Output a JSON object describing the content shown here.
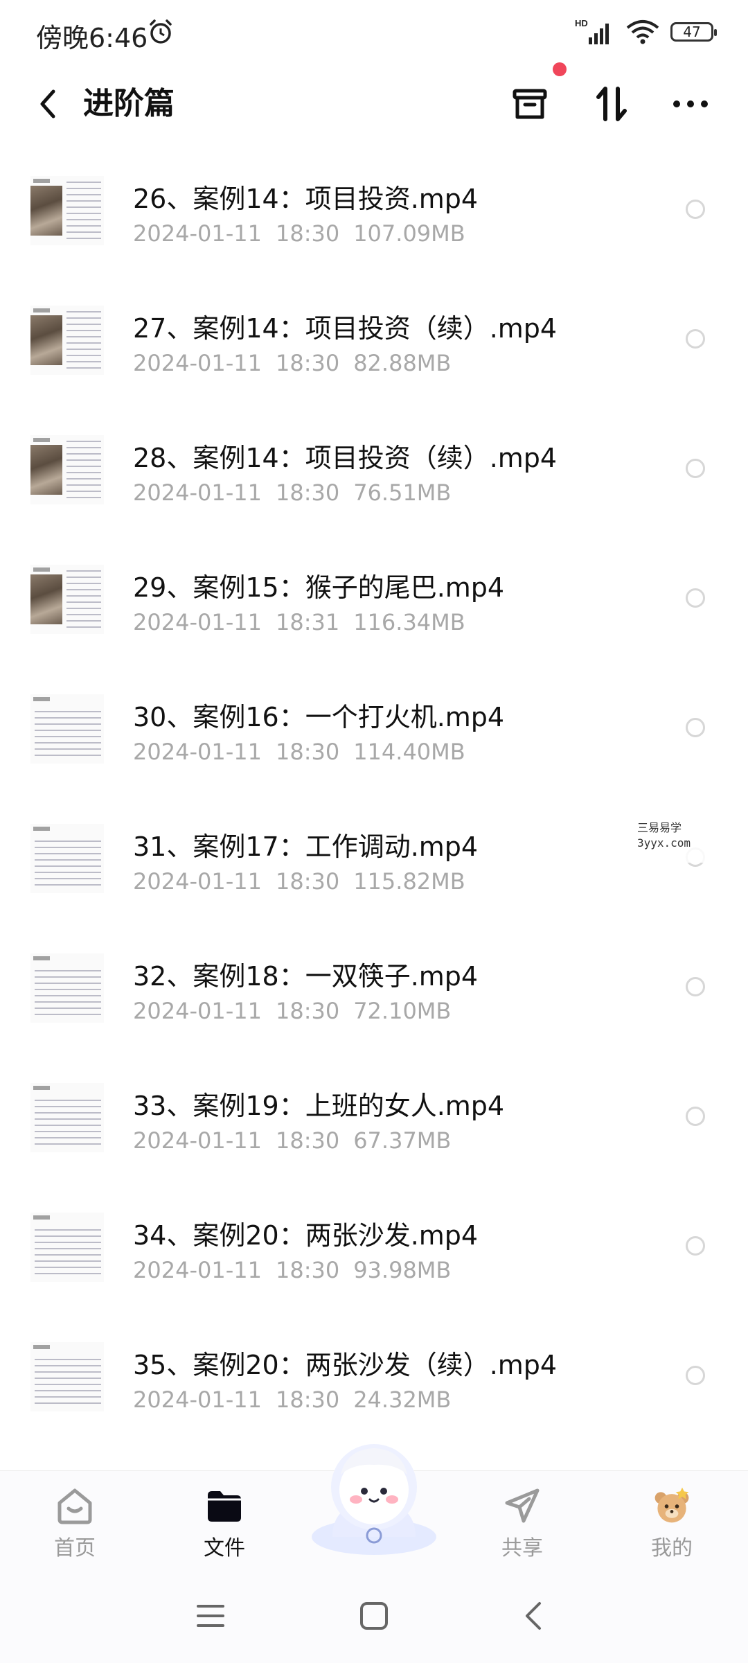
{
  "status_bar": {
    "time": "傍晚6:46",
    "network_badge": "HD",
    "battery": "47",
    "icons": [
      "alarm-icon",
      "signal-icon",
      "wifi-icon",
      "battery-icon"
    ]
  },
  "header": {
    "title": "进阶篇",
    "icons": [
      "back-icon",
      "archive-icon",
      "sort-icon",
      "more-icon"
    ],
    "badge_color": "#f0465a"
  },
  "files": [
    {
      "name": "26、案例14：项目投资.mp4",
      "date": "2024-01-11",
      "time": "18:30",
      "size": "107.09MB",
      "thumb": "photo"
    },
    {
      "name": "27、案例14：项目投资（续）.mp4",
      "date": "2024-01-11",
      "time": "18:30",
      "size": "82.88MB",
      "thumb": "photo"
    },
    {
      "name": "28、案例14：项目投资（续）.mp4",
      "date": "2024-01-11",
      "time": "18:30",
      "size": "76.51MB",
      "thumb": "photo"
    },
    {
      "name": "29、案例15：猴子的尾巴.mp4",
      "date": "2024-01-11",
      "time": "18:31",
      "size": "116.34MB",
      "thumb": "photo"
    },
    {
      "name": "30、案例16：一个打火机.mp4",
      "date": "2024-01-11",
      "time": "18:30",
      "size": "114.40MB",
      "thumb": "text"
    },
    {
      "name": "31、案例17：工作调动.mp4",
      "date": "2024-01-11",
      "time": "18:30",
      "size": "115.82MB",
      "thumb": "text"
    },
    {
      "name": "32、案例18：一双筷子.mp4",
      "date": "2024-01-11",
      "time": "18:30",
      "size": "72.10MB",
      "thumb": "text"
    },
    {
      "name": "33、案例19：上班的女人.mp4",
      "date": "2024-01-11",
      "time": "18:30",
      "size": "67.37MB",
      "thumb": "text"
    },
    {
      "name": "34、案例20：两张沙发.mp4",
      "date": "2024-01-11",
      "time": "18:30",
      "size": "93.98MB",
      "thumb": "text"
    },
    {
      "name": "35、案例20：两张沙发（续）.mp4",
      "date": "2024-01-11",
      "time": "18:30",
      "size": "24.32MB",
      "thumb": "text"
    }
  ],
  "watermark": {
    "line1": "三易易学",
    "line2": "3yyx.com"
  },
  "tabs": [
    {
      "label": "首页",
      "icon": "home-icon",
      "active": false
    },
    {
      "label": "文件",
      "icon": "folder-icon",
      "active": true
    },
    {
      "label": "共享",
      "icon": "share-icon",
      "active": false
    },
    {
      "label": "我的",
      "icon": "profile-bear-icon",
      "active": false
    }
  ],
  "nav": [
    "menu-icon",
    "home-square-icon",
    "back-chevron-icon"
  ]
}
